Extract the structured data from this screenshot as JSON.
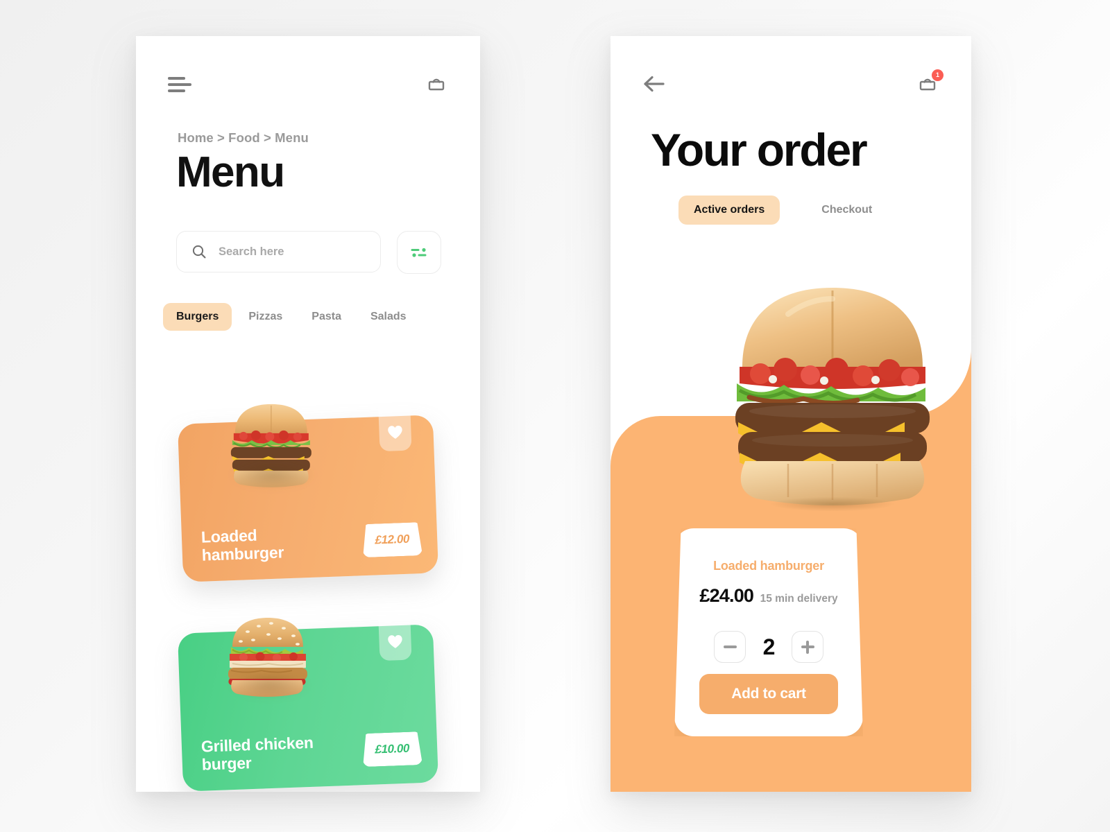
{
  "menu_screen": {
    "header": {
      "menu_icon": "hamburger-menu-icon",
      "bag_icon": "shopping-bag-icon"
    },
    "breadcrumb": "Home > Food > Menu",
    "title": "Menu",
    "search": {
      "placeholder": "Search here",
      "value": "",
      "icon": "search-icon",
      "filter_icon": "filter-sliders-icon",
      "filter_color": "#4ECB79"
    },
    "categories": [
      {
        "label": "Burgers",
        "active": true
      },
      {
        "label": "Pizzas",
        "active": false
      },
      {
        "label": "Pasta",
        "active": false
      },
      {
        "label": "Salads",
        "active": false
      }
    ],
    "active_tab_bg": "#FBDCB7",
    "items": [
      {
        "name": "Loaded hamburger",
        "price": "£12.00",
        "accent": "#F6AD6F",
        "price_color": "#F0A05A",
        "favorite_icon": "heart-icon",
        "image": "loaded-hamburger-photo"
      },
      {
        "name": "Grilled chicken burger",
        "price": "£10.00",
        "accent": "#5ED694",
        "price_color": "#35BF72",
        "favorite_icon": "heart-icon",
        "image": "grilled-chicken-burger-photo"
      }
    ]
  },
  "order_screen": {
    "header": {
      "back_icon": "arrow-left-icon",
      "bag_icon": "shopping-bag-icon",
      "cart_badge": "1",
      "badge_color": "#FB5D54"
    },
    "title": "Your order",
    "tabs": [
      {
        "label": "Active orders",
        "active": true
      },
      {
        "label": "Checkout",
        "active": false
      }
    ],
    "panel_color": "#FCB473",
    "hero_image": "loaded-hamburger-photo",
    "detail": {
      "name": "Loaded hamburger",
      "price": "£24.00",
      "delivery": "15 min delivery",
      "quantity": "2",
      "decrease_label": "minus-icon",
      "increase_label": "plus-icon",
      "add_to_cart_label": "Add to cart",
      "button_color": "#F6AD6C",
      "name_color": "#F6AD6C"
    }
  }
}
